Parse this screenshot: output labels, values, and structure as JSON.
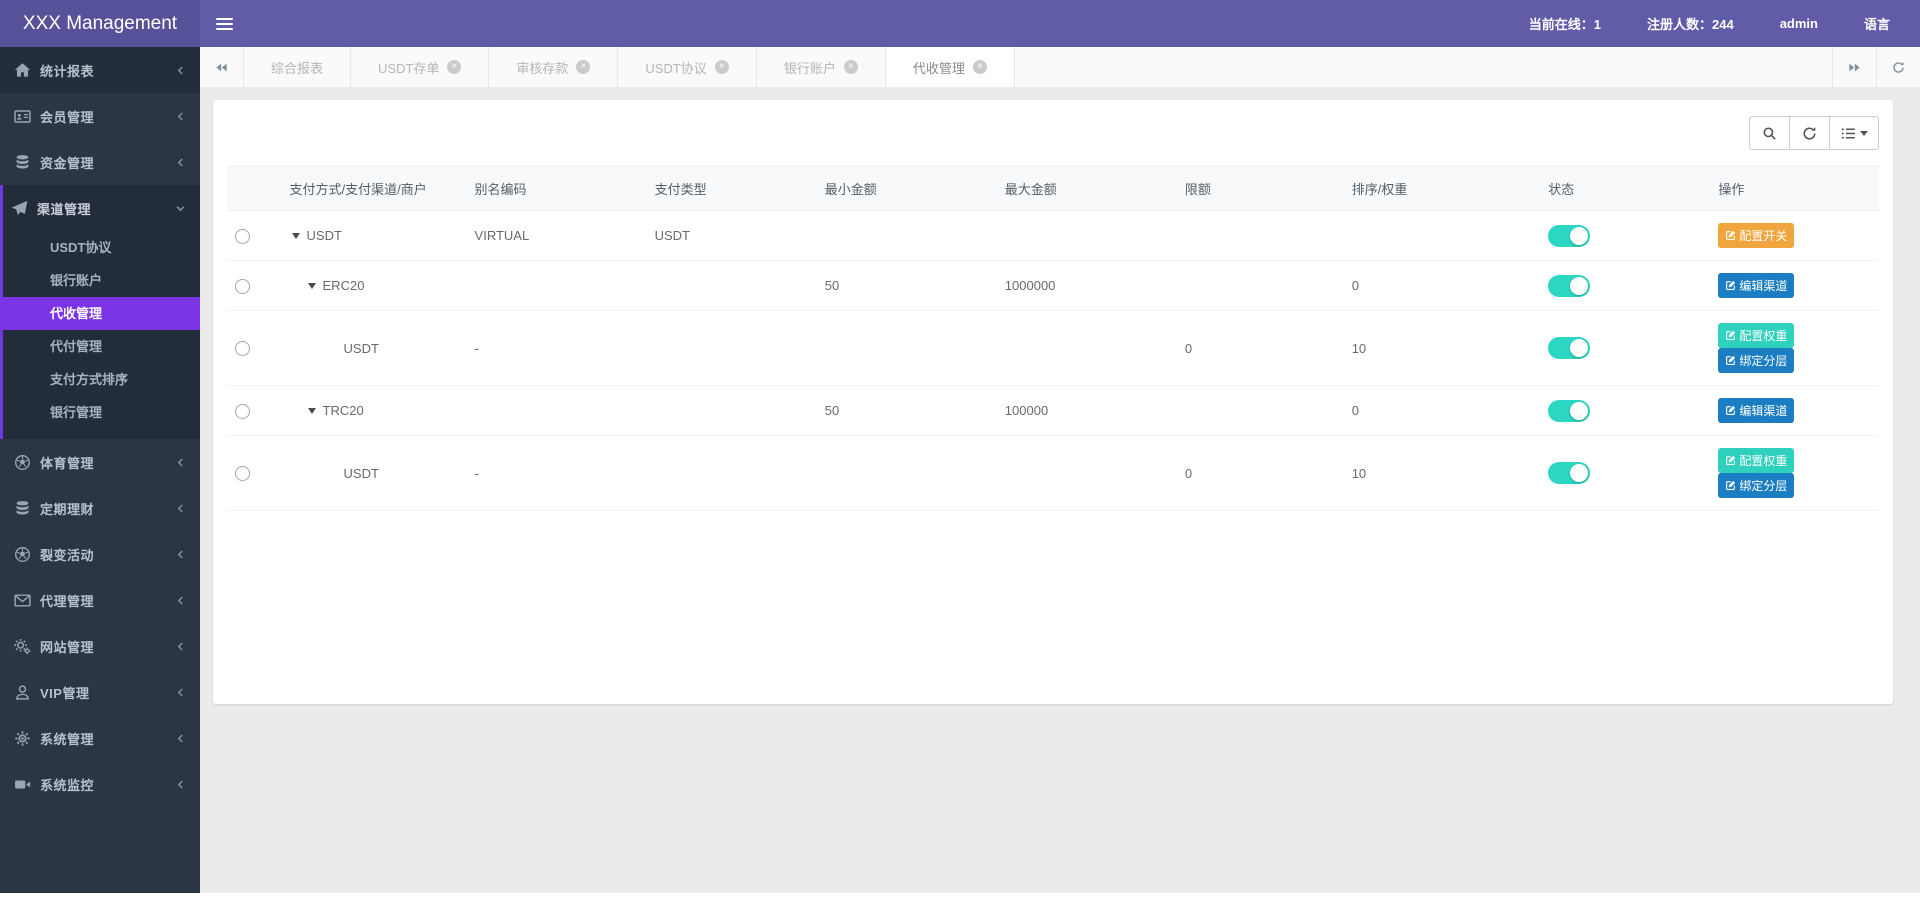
{
  "header": {
    "brand": "XXX Management",
    "online": "当前在线：1",
    "registered": "注册人数：244",
    "user": "admin",
    "language": "语言"
  },
  "sidebar": {
    "items": [
      {
        "label": "统计报表",
        "icon": "home"
      },
      {
        "label": "会员管理",
        "icon": "id-card"
      },
      {
        "label": "资金管理",
        "icon": "database"
      },
      {
        "label": "渠道管理",
        "icon": "paper-plane",
        "expanded": true,
        "children": [
          {
            "label": "USDT协议"
          },
          {
            "label": "银行账户"
          },
          {
            "label": "代收管理",
            "active": true
          },
          {
            "label": "代付管理"
          },
          {
            "label": "支付方式排序"
          },
          {
            "label": "银行管理"
          }
        ]
      },
      {
        "label": "体育管理",
        "icon": "soccer"
      },
      {
        "label": "定期理财",
        "icon": "database"
      },
      {
        "label": "裂变活动",
        "icon": "soccer"
      },
      {
        "label": "代理管理",
        "icon": "envelope"
      },
      {
        "label": "网站管理",
        "icon": "cogs"
      },
      {
        "label": "VIP管理",
        "icon": "user"
      },
      {
        "label": "系统管理",
        "icon": "gear"
      },
      {
        "label": "系统监控",
        "icon": "video"
      }
    ]
  },
  "tabs": [
    {
      "label": "综合报表",
      "closable": false
    },
    {
      "label": "USDT存单",
      "closable": true
    },
    {
      "label": "审核存款",
      "closable": true
    },
    {
      "label": "USDT协议",
      "closable": true
    },
    {
      "label": "银行账户",
      "closable": true
    },
    {
      "label": "代收管理",
      "closable": true,
      "active": true
    }
  ],
  "card_toolbar": {
    "buttons": [
      {
        "icon": "search-icon"
      },
      {
        "icon": "refresh-icon"
      },
      {
        "icon": "list-columns-icon"
      }
    ]
  },
  "table": {
    "columns": [
      "",
      "支付方式/支付渠道/商户",
      "别名编码",
      "支付类型",
      "最小金额",
      "最大金额",
      "限额",
      "排序/权重",
      "状态",
      "操作"
    ],
    "rows": [
      {
        "name": "USDT",
        "alias": "VIRTUAL",
        "type": "USDT",
        "min": "",
        "max": "",
        "limit": "",
        "weight": "",
        "toggle": "on",
        "actions": [
          {
            "label": "配置开关",
            "color": "orange"
          }
        ]
      },
      {
        "name": "ERC20",
        "alias": "",
        "type": "",
        "min": "50",
        "max": "1000000",
        "limit": "",
        "weight": "0",
        "toggle": "on",
        "actions": [
          {
            "label": "编辑渠道",
            "color": "blue"
          }
        ]
      },
      {
        "name": "USDT",
        "alias": "-",
        "type": "",
        "min": "",
        "max": "",
        "limit": "0",
        "weight": "10",
        "toggle": "on",
        "actions": [
          {
            "label": "配置权重",
            "color": "teal"
          },
          {
            "label": "绑定分层",
            "color": "blue"
          }
        ]
      },
      {
        "name": "TRC20",
        "alias": "",
        "type": "",
        "min": "50",
        "max": "100000",
        "limit": "",
        "weight": "0",
        "toggle": "on",
        "actions": [
          {
            "label": "编辑渠道",
            "color": "blue"
          }
        ]
      },
      {
        "name": "USDT",
        "alias": "-",
        "type": "",
        "min": "",
        "max": "",
        "limit": "0",
        "weight": "10",
        "toggle": "on",
        "actions": [
          {
            "label": "配置权重",
            "color": "teal"
          },
          {
            "label": "绑定分层",
            "color": "blue"
          }
        ]
      }
    ]
  },
  "colors": {
    "navbar": "#605ca8",
    "logo_bg": "#555299",
    "sidebar_bg": "#2b3544",
    "sidebar_active": "#7b33e6",
    "toggle_on": "#2bd6c3",
    "btn_orange": "#f0a53e",
    "btn_blue": "#1b7ec2",
    "btn_teal": "#2fd0bd"
  }
}
